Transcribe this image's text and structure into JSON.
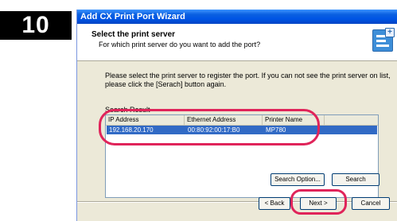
{
  "step": "10",
  "window": {
    "title": "Add CX Print Port Wizard"
  },
  "header": {
    "title": "Select the print server",
    "subtitle": "For which print server do you want to add the port?",
    "icon": "wizard-printer-icon"
  },
  "instructions": "Please select the print server to register the port. If you can not see the print server on list, please click the [Serach] button again.",
  "results": {
    "label": "Search Result",
    "columns": [
      "IP Address",
      "Ethernet Address",
      "Printer Name"
    ],
    "rows": [
      {
        "ip": "192.168.20.170",
        "mac": "00:80:92:00:17:B0",
        "printer": "MP780",
        "selected": true
      }
    ]
  },
  "buttons": {
    "search_option": "Search Option...",
    "search": "Search",
    "back": "< Back",
    "next": "Next >",
    "cancel": "Cancel"
  },
  "colors": {
    "titlebar": "#0055e5",
    "selection": "#316ac5",
    "highlight": "#e0245a",
    "dialog_bg": "#ece9d8"
  }
}
